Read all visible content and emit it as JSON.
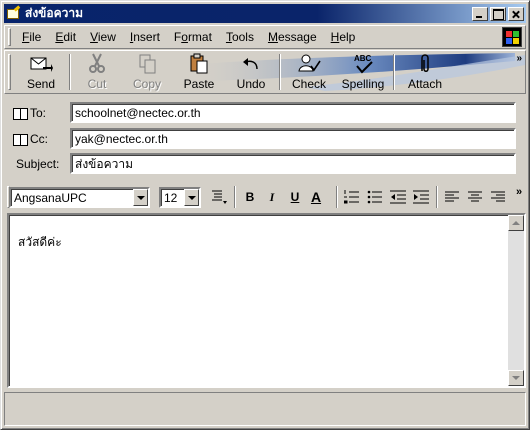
{
  "window": {
    "title": "ส่งข้อความ",
    "controls": [
      "minimize",
      "maximize",
      "close"
    ]
  },
  "menu": {
    "items": [
      {
        "label": "File",
        "accel": "F",
        "rest": "ile"
      },
      {
        "label": "Edit",
        "accel": "E",
        "rest": "dit"
      },
      {
        "label": "View",
        "accel": "V",
        "rest": "iew"
      },
      {
        "label": "Insert",
        "accel": "I",
        "rest": "nsert"
      },
      {
        "label": "Format",
        "pre": "F",
        "accel": "o",
        "rest": "rmat"
      },
      {
        "label": "Tools",
        "accel": "T",
        "rest": "ools"
      },
      {
        "label": "Message",
        "accel": "M",
        "rest": "essage"
      },
      {
        "label": "Help",
        "accel": "H",
        "rest": "elp"
      }
    ]
  },
  "toolbar": {
    "send": "Send",
    "cut": "Cut",
    "copy": "Copy",
    "paste": "Paste",
    "undo": "Undo",
    "check": "Check",
    "spelling": "Spelling",
    "attach": "Attach",
    "spelling_icon_text": "ABC",
    "more": "»"
  },
  "header": {
    "to_label": "To:",
    "to_value": "schoolnet@nectec.or.th",
    "cc_label": "Cc:",
    "cc_value": "yak@nectec.or.th",
    "subject_label": "Subject:",
    "subject_value": "ส่งข้อความ"
  },
  "format": {
    "font": "AngsanaUPC",
    "size": "12",
    "bold": "B",
    "italic": "I",
    "underline": "U",
    "font_color": "A",
    "more": "»"
  },
  "body": {
    "text": "สวัสดีค่ะ"
  },
  "colors": {
    "titlebar_start": "#08246b",
    "titlebar_end": "#a6caf0",
    "chrome": "#d4d0c8"
  }
}
